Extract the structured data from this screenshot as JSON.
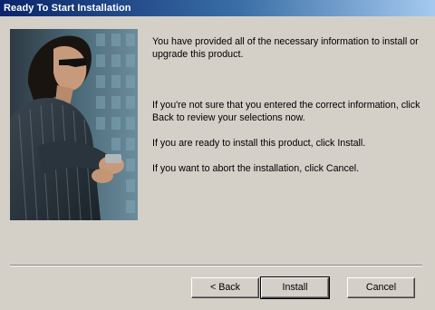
{
  "window": {
    "title": "Ready To Start Installation"
  },
  "photo": {
    "description_icon": "person-with-phone-image"
  },
  "content": {
    "paragraphs": [
      "You have provided all of the necessary information to install or upgrade this product.",
      "If you're not sure that you entered the correct information, click Back to review your selections now.",
      "If you are ready to install this product, click Install.",
      "If you want to abort the installation, click Cancel."
    ]
  },
  "buttons": {
    "back": "< Back",
    "install": "Install",
    "cancel": "Cancel"
  },
  "colors": {
    "title_bar_start": "#0a246a",
    "title_bar_end": "#a6caf0",
    "dialog_bg": "#d4d0c8"
  }
}
